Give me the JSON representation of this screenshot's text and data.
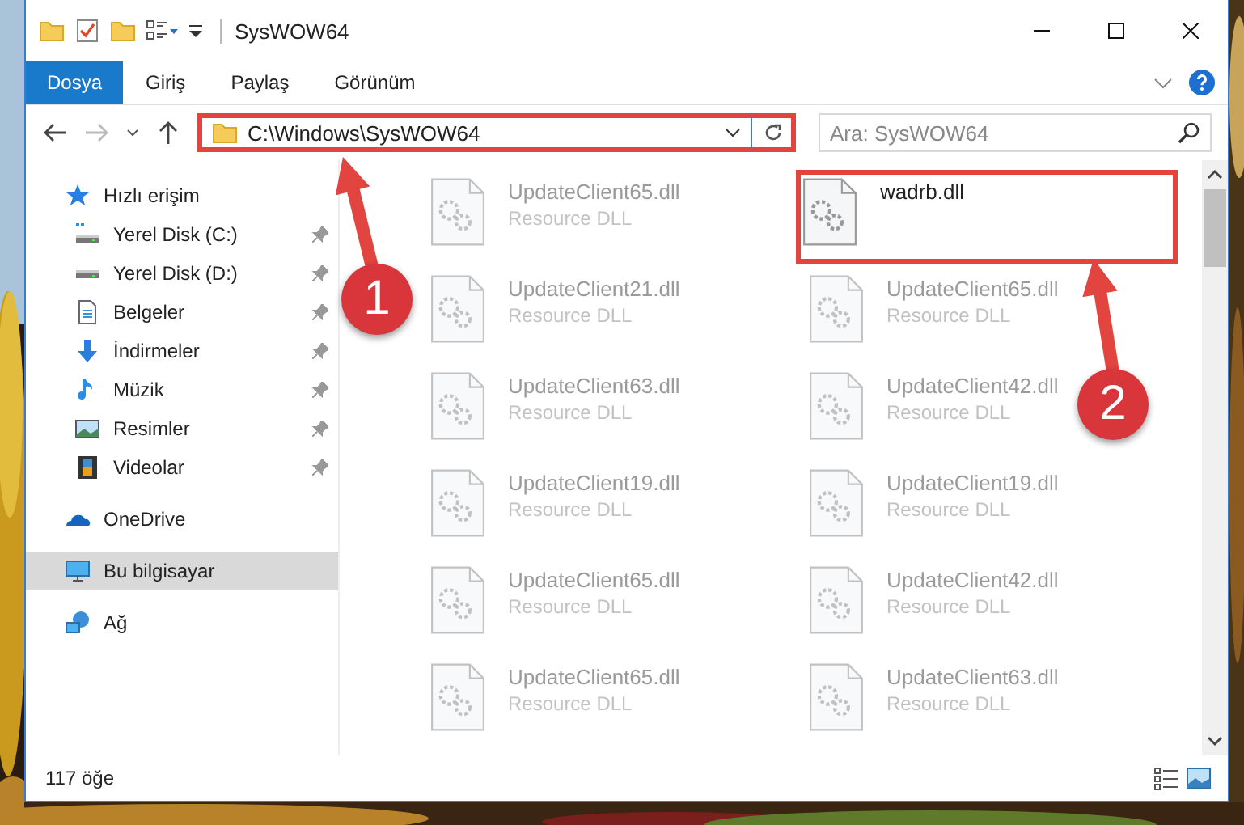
{
  "window": {
    "title": "SysWOW64"
  },
  "ribbon_tabs": [
    {
      "label": "Dosya",
      "selected": true
    },
    {
      "label": "Giriş",
      "selected": false
    },
    {
      "label": "Paylaş",
      "selected": false
    },
    {
      "label": "Görünüm",
      "selected": false
    }
  ],
  "address": {
    "path": "C:\\Windows\\SysWOW64",
    "highlighted": true
  },
  "search": {
    "placeholder": "Ara: SysWOW64"
  },
  "sidebar": {
    "items": [
      {
        "label": "Hızlı erişim",
        "kind": "star",
        "selected": false,
        "children": [
          {
            "label": "Yerel Disk (C:)",
            "kind": "system-drive",
            "pinned": true,
            "selected": false
          },
          {
            "label": "Yerel Disk (D:)",
            "kind": "drive",
            "pinned": true,
            "selected": false
          },
          {
            "label": "Belgeler",
            "kind": "documents",
            "pinned": true,
            "selected": false
          },
          {
            "label": "İndirmeler",
            "kind": "downloads",
            "pinned": true,
            "selected": false
          },
          {
            "label": "Müzik",
            "kind": "music",
            "pinned": true,
            "selected": false
          },
          {
            "label": "Resimler",
            "kind": "pictures",
            "pinned": true,
            "selected": false
          },
          {
            "label": "Videolar",
            "kind": "videos",
            "pinned": true,
            "selected": false
          }
        ]
      },
      {
        "label": "OneDrive",
        "kind": "cloud",
        "selected": false
      },
      {
        "label": "Bu bilgisayar",
        "kind": "computer",
        "selected": true
      },
      {
        "label": "Ağ",
        "kind": "network",
        "selected": false
      }
    ]
  },
  "files": [
    {
      "name": "UpdateClient65.dll",
      "type": "Resource DLL",
      "blurred": true,
      "highlighted": false
    },
    {
      "name": "wadrb.dll",
      "blurred": false,
      "highlighted": true
    },
    {
      "name": "UpdateClient21.dll",
      "type": "Resource DLL",
      "blurred": true,
      "highlighted": false
    },
    {
      "name": "UpdateClient65.dll",
      "type": "Resource DLL",
      "blurred": true,
      "highlighted": false
    },
    {
      "name": "UpdateClient63.dll",
      "type": "Resource DLL",
      "blurred": true,
      "highlighted": false
    },
    {
      "name": "UpdateClient42.dll",
      "type": "Resource DLL",
      "blurred": true,
      "highlighted": false
    },
    {
      "name": "UpdateClient19.dll",
      "type": "Resource DLL",
      "blurred": true,
      "highlighted": false
    },
    {
      "name": "UpdateClient19.dll",
      "type": "Resource DLL",
      "blurred": true,
      "highlighted": false
    },
    {
      "name": "UpdateClient65.dll",
      "type": "Resource DLL",
      "blurred": true,
      "highlighted": false
    },
    {
      "name": "UpdateClient42.dll",
      "type": "Resource DLL",
      "blurred": true,
      "highlighted": false
    },
    {
      "name": "UpdateClient65.dll",
      "type": "Resource DLL",
      "blurred": true,
      "highlighted": false
    },
    {
      "name": "UpdateClient63.dll",
      "type": "Resource DLL",
      "blurred": true,
      "highlighted": false
    }
  ],
  "annotations": [
    {
      "number": "1"
    },
    {
      "number": "2"
    }
  ],
  "status_bar": {
    "item_count": "117 öğe"
  }
}
